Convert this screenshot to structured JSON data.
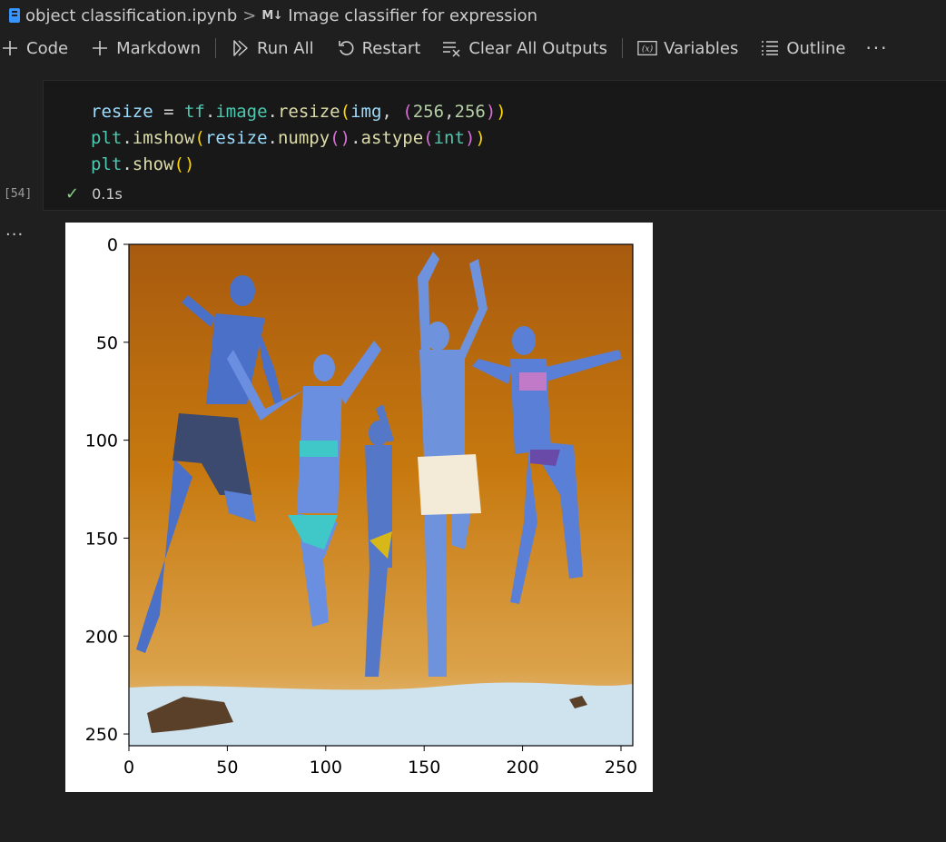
{
  "breadcrumb": {
    "file": "object classification.ipynb",
    "separator": ">",
    "markdown_badge": "M↓",
    "heading": "Image classifier for expression"
  },
  "toolbar": {
    "code_label": "Code",
    "markdown_label": "Markdown",
    "run_all_label": "Run All",
    "restart_label": "Restart",
    "clear_outputs_label": "Clear All Outputs",
    "variables_label": "Variables",
    "outline_label": "Outline",
    "more_label": "···"
  },
  "cell": {
    "execution_count": "[54]",
    "status_time": "0.1s",
    "output_more": "···"
  },
  "chart_data": {
    "type": "image",
    "x_ticks": [
      "0",
      "50",
      "100",
      "150",
      "200",
      "250"
    ],
    "y_ticks": [
      "0",
      "50",
      "100",
      "150",
      "200",
      "250"
    ],
    "xlim": [
      0,
      256
    ],
    "ylim": [
      256,
      0
    ],
    "image_description": "five people jumping against an orange sky on sand, rendered with swapped color channels (blue skin tones)"
  },
  "colors": {
    "background": "#1f1f1f",
    "cell_background": "#181818",
    "check_green": "#89d185"
  }
}
